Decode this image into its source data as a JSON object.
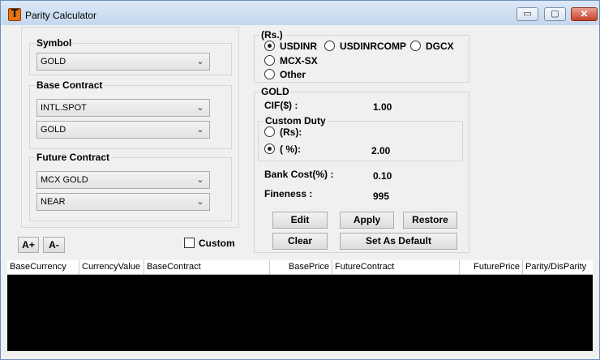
{
  "window": {
    "title": "Parity Calculator",
    "app_icon_glyph": "T",
    "min_glyph": "▭",
    "max_glyph": "▢",
    "close_glyph": "✕"
  },
  "symbol": {
    "legend": "Symbol",
    "value": "GOLD"
  },
  "base_contract": {
    "legend": "Base Contract",
    "value1": "INTL.SPOT",
    "value2": "GOLD"
  },
  "future_contract": {
    "legend": "Future Contract",
    "value1": "MCX GOLD",
    "value2": "NEAR"
  },
  "font_buttons": {
    "increase": "A+",
    "decrease": "A-"
  },
  "custom": {
    "label": "Custom",
    "checked": false
  },
  "currency": {
    "legend": "(Rs.)",
    "options": [
      {
        "label": "USDINR",
        "selected": true
      },
      {
        "label": "USDINRCOMP",
        "selected": false
      },
      {
        "label": "DGCX",
        "selected": false
      },
      {
        "label": "MCX-SX",
        "selected": false
      },
      {
        "label": "Other",
        "selected": false
      }
    ]
  },
  "details": {
    "legend": "GOLD",
    "cif_label": "CIF($) :",
    "cif_value": "1.00",
    "custom_duty": {
      "legend": "Custom Duty",
      "rs_label": "(Rs):",
      "pct_label": "( %):",
      "pct_value": "2.00",
      "rs_selected": false,
      "pct_selected": true
    },
    "bank_cost_label": "Bank Cost(%) :",
    "bank_cost_value": "0.10",
    "fineness_label": "Fineness :",
    "fineness_value": "995"
  },
  "actions": {
    "edit": "Edit",
    "apply": "Apply",
    "restore": "Restore",
    "clear": "Clear",
    "set_default": "Set As Default"
  },
  "grid": {
    "columns": [
      "BaseCurrency",
      "CurrencyValue",
      "BaseContract",
      "BasePrice",
      "FutureContract",
      "FuturePrice",
      "Parity/DisParity"
    ]
  },
  "colors": {
    "accent_icon": "#e8730f",
    "grid_background": "#000000",
    "close_button": "#c8412b"
  }
}
